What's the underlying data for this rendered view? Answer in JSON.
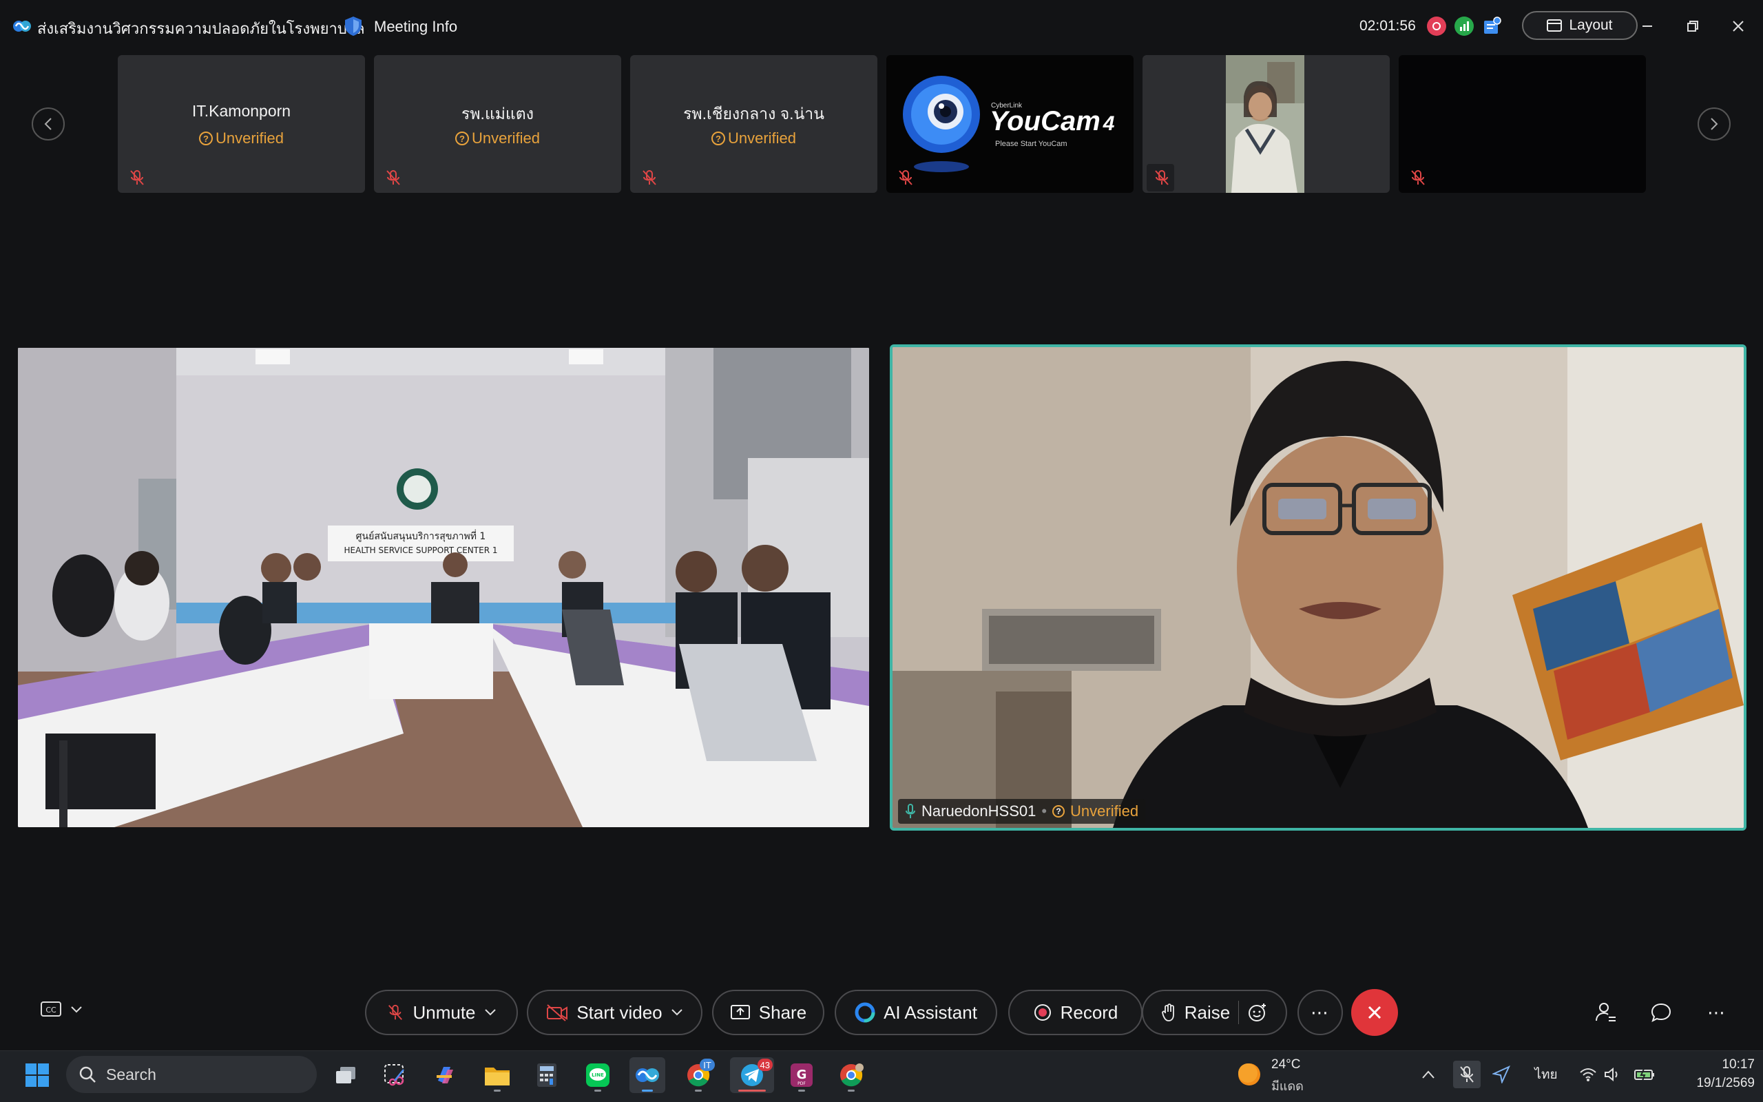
{
  "titlebar": {
    "meeting_title": "ส่งเสริมงานวิศวกรรมความปลอดภัยในโรงพยาบาล",
    "meeting_info_label": "Meeting Info",
    "timer": "02:01:56",
    "layout_label": "Layout"
  },
  "thumbnails": [
    {
      "name": "IT.Kamonporn",
      "status": "Unverified",
      "kind": "name"
    },
    {
      "name": "รพ.แม่แตง",
      "status": "Unverified",
      "kind": "name"
    },
    {
      "name": "รพ.เชียงกลาง จ.น่าน",
      "status": "Unverified",
      "kind": "name"
    },
    {
      "name": "",
      "status": "",
      "kind": "youcam",
      "brand_small": "CyberLink",
      "brand": "YouCam",
      "brand_num": "4",
      "brand_caption": "Please Start YouCam"
    },
    {
      "name": "",
      "status": "",
      "kind": "video"
    },
    {
      "name": "",
      "status": "",
      "kind": "black"
    }
  ],
  "main_tiles": {
    "left": {
      "sign_th": "ศูนย์สนับสนุนบริการสุขภาพที่ 1",
      "sign_en": "HEALTH SERVICE SUPPORT CENTER 1"
    },
    "right": {
      "name": "NaruedonHSS01",
      "status": "Unverified"
    }
  },
  "controls": {
    "unmute": "Unmute",
    "start_video": "Start video",
    "share": "Share",
    "ai_assistant": "AI Assistant",
    "record": "Record",
    "raise": "Raise"
  },
  "taskbar": {
    "search_placeholder": "Search",
    "telegram_badge": "43",
    "chrome_badge": "IT",
    "weather_temp": "24°C",
    "weather_desc": "มีแดด",
    "language": "ไทย",
    "time": "10:17",
    "date": "19/1/2569"
  },
  "colors": {
    "accent_teal": "#3fb5a5",
    "unverified": "#e9a33c",
    "end_call": "#e0353a"
  }
}
